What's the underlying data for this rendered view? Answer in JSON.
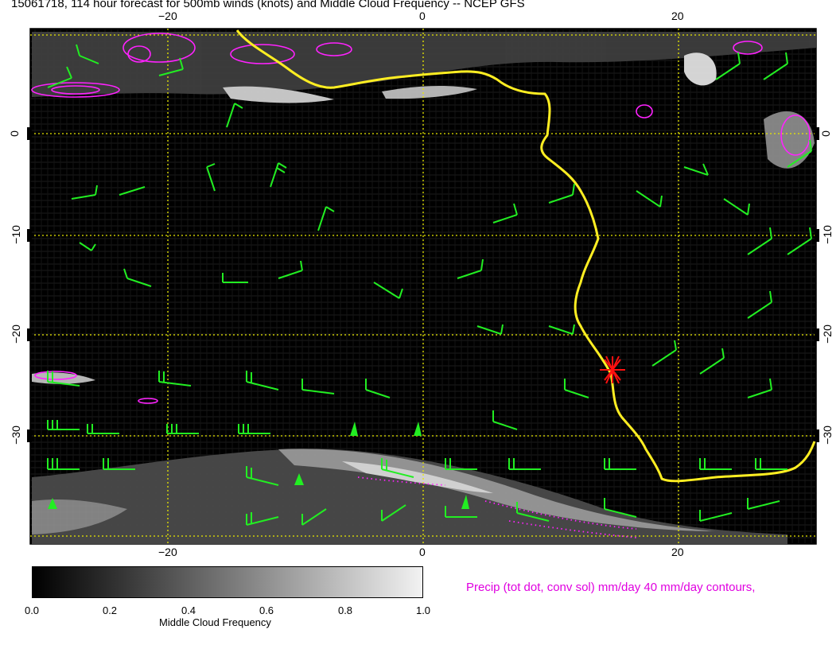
{
  "title": "15061718, 114 hour forecast for 500mb winds (knots) and Middle Cloud Frequency -- NCEP GFS",
  "x_ticks_top": [
    "−20",
    "0",
    "20"
  ],
  "x_ticks_bottom": [
    "−20",
    "0",
    "20"
  ],
  "y_ticks_left": [
    "0",
    "−10",
    "−20",
    "−30"
  ],
  "y_ticks_right": [
    "0",
    "−10",
    "−20",
    "−30"
  ],
  "colorbar": {
    "ticks": [
      "0.0",
      "0.2",
      "0.4",
      "0.6",
      "0.8",
      "1.0"
    ],
    "label": "Middle Cloud Frequency"
  },
  "precip_label": "Precip (tot dot, conv sol) mm/day 40 mm/day contours,",
  "colors": {
    "background": "#000000",
    "gridlines": "#e8e800",
    "wind_barbs": "#22ee22",
    "coastline": "#ffee22",
    "precip_contours": "#ff22ff",
    "marker": "#ff1010"
  },
  "map_data": {
    "lon_range": [
      -31,
      31
    ],
    "lat_range": [
      -41,
      10
    ],
    "grid_lon": [
      -20,
      0,
      20
    ],
    "grid_lat": [
      8,
      0,
      -10,
      -20,
      -30,
      -40
    ],
    "marker": {
      "lon": 15.2,
      "lat": -23.6,
      "symbol": "red star"
    }
  }
}
